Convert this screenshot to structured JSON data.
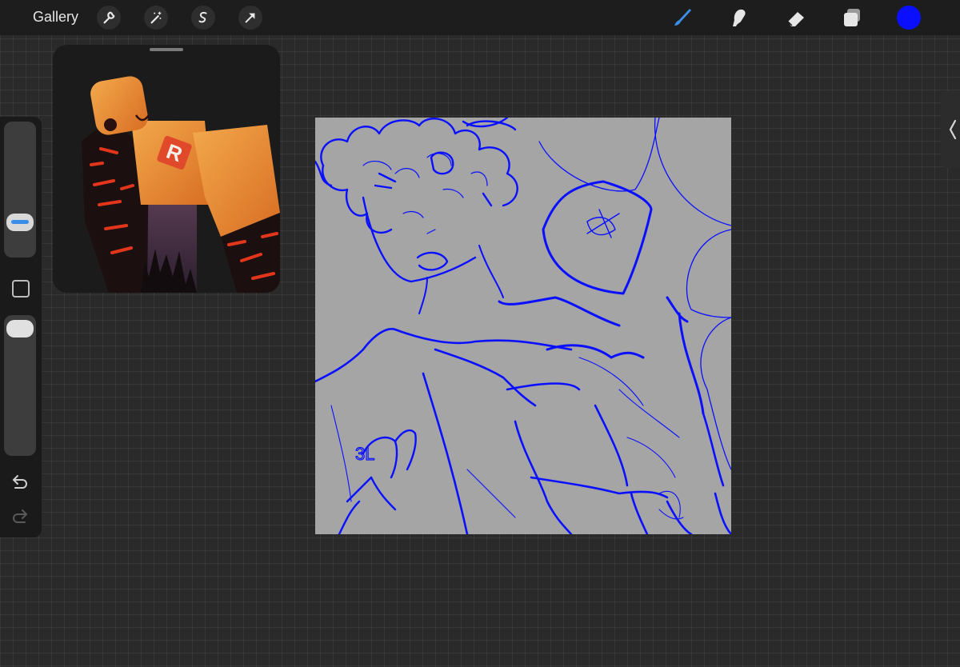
{
  "topbar": {
    "gallery_label": "Gallery",
    "left_tools": [
      "wrench-icon",
      "magic-wand-icon",
      "selection-s-icon",
      "transform-arrow-icon"
    ],
    "right_tools": [
      "brush-icon",
      "smudge-icon",
      "eraser-icon",
      "layers-icon"
    ],
    "current_color": "#0a10ff",
    "active_tool_color": "#3b8ee8"
  },
  "sidebar": {
    "brush_size_icon": "brush-size-slider",
    "modify_button_icon": "square-icon",
    "opacity_icon": "opacity-slider",
    "undo_icon": "undo-icon",
    "redo_icon": "redo-icon"
  },
  "reference": {
    "logo_text": "R"
  },
  "canvas": {
    "background": "#a5a5a5",
    "stroke_color": "#0a10ff",
    "sketch_text": "3L"
  }
}
